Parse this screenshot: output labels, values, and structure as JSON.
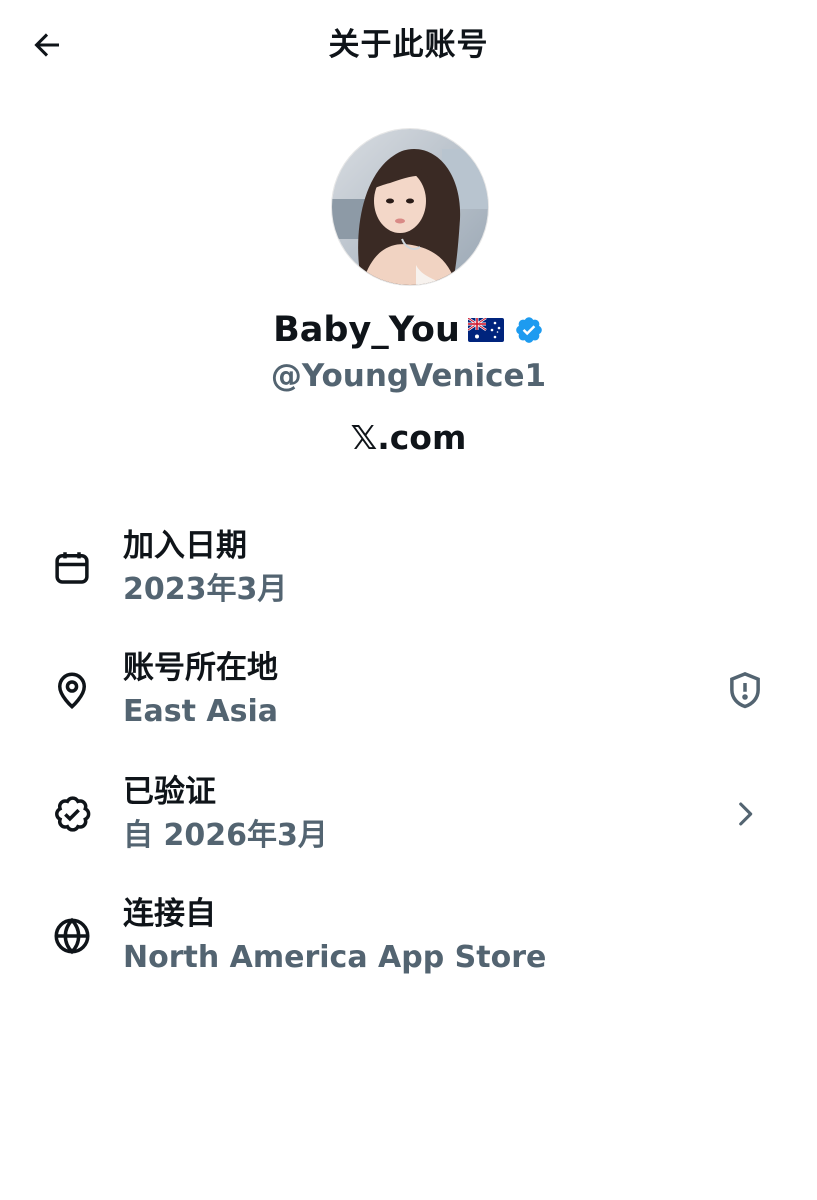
{
  "header": {
    "back_icon": "arrow-left-icon",
    "title": "关于此账号"
  },
  "profile": {
    "avatar_icon": "profile-photo",
    "display_name": "Baby_You",
    "flag_icon": "australia-flag-icon",
    "verified_icon": "verified-badge-icon",
    "verified_color": "#1d9bf0",
    "handle": "@YoungVenice1",
    "site": "𝕏.com"
  },
  "details": [
    {
      "icon": "calendar-icon",
      "label": "加入日期",
      "value": "2023年3月"
    },
    {
      "icon": "location-pin-icon",
      "label": "账号所在地",
      "value": "East Asia",
      "trailing_icon": "shield-alert-icon"
    },
    {
      "icon": "verified-check-icon",
      "label": "已验证",
      "value": "自 2026年3月",
      "trailing_icon": "chevron-right-icon"
    },
    {
      "icon": "globe-icon",
      "label": "连接自",
      "value": "North America App Store"
    }
  ],
  "colors": {
    "text_primary": "#0f1419",
    "text_secondary": "#536471",
    "background": "#ffffff"
  }
}
